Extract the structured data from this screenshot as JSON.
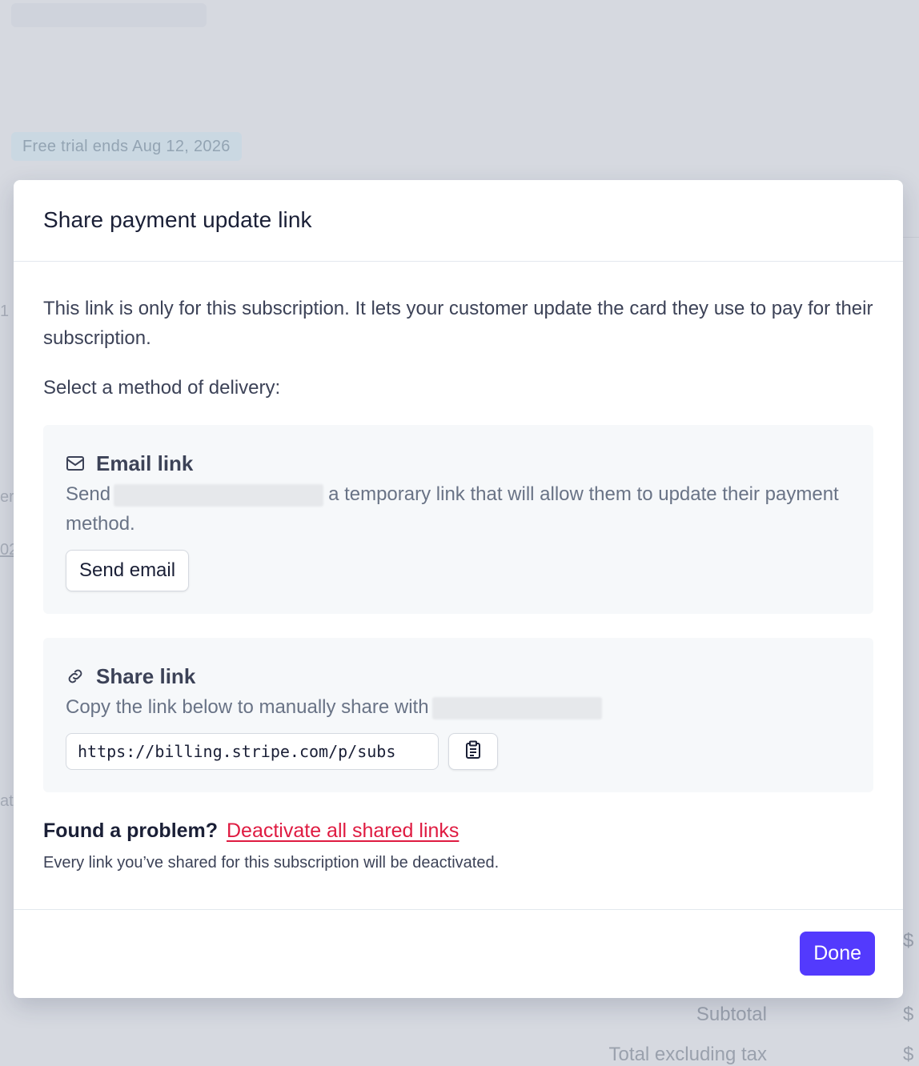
{
  "background": {
    "trial_badge": "Free trial ends Aug 12, 2026",
    "edge_fragments": [
      "1",
      "er",
      "02",
      "at",
      "$"
    ],
    "summary": {
      "subtotal_label": "Subtotal",
      "subtotal_value": "$",
      "total_excl_tax_label": "Total excluding tax",
      "total_excl_tax_value": "$"
    }
  },
  "modal": {
    "title": "Share payment update link",
    "intro": "This link is only for this subscription. It lets your customer update the card they use to pay for their subscription.",
    "delivery_label": "Select a method of delivery:",
    "email_option": {
      "icon": "mail-icon",
      "title": "Email link",
      "desc_prefix": "Send",
      "desc_suffix": "a temporary link that will allow them to update their payment method.",
      "button_label": "Send email"
    },
    "share_option": {
      "icon": "link-icon",
      "title": "Share link",
      "desc_prefix": "Copy the link below to manually share with",
      "link_value": "https://billing.stripe.com/p/subs",
      "copy_icon": "clipboard-icon"
    },
    "problem": {
      "question": "Found a problem?",
      "link_label": "Deactivate all shared links",
      "note": "Every link you’ve shared for this subscription will be deactivated."
    },
    "done_label": "Done"
  },
  "colors": {
    "primary": "#533afd",
    "danger_link": "#df1b41",
    "overlay_bg": "#d6d9e0"
  }
}
